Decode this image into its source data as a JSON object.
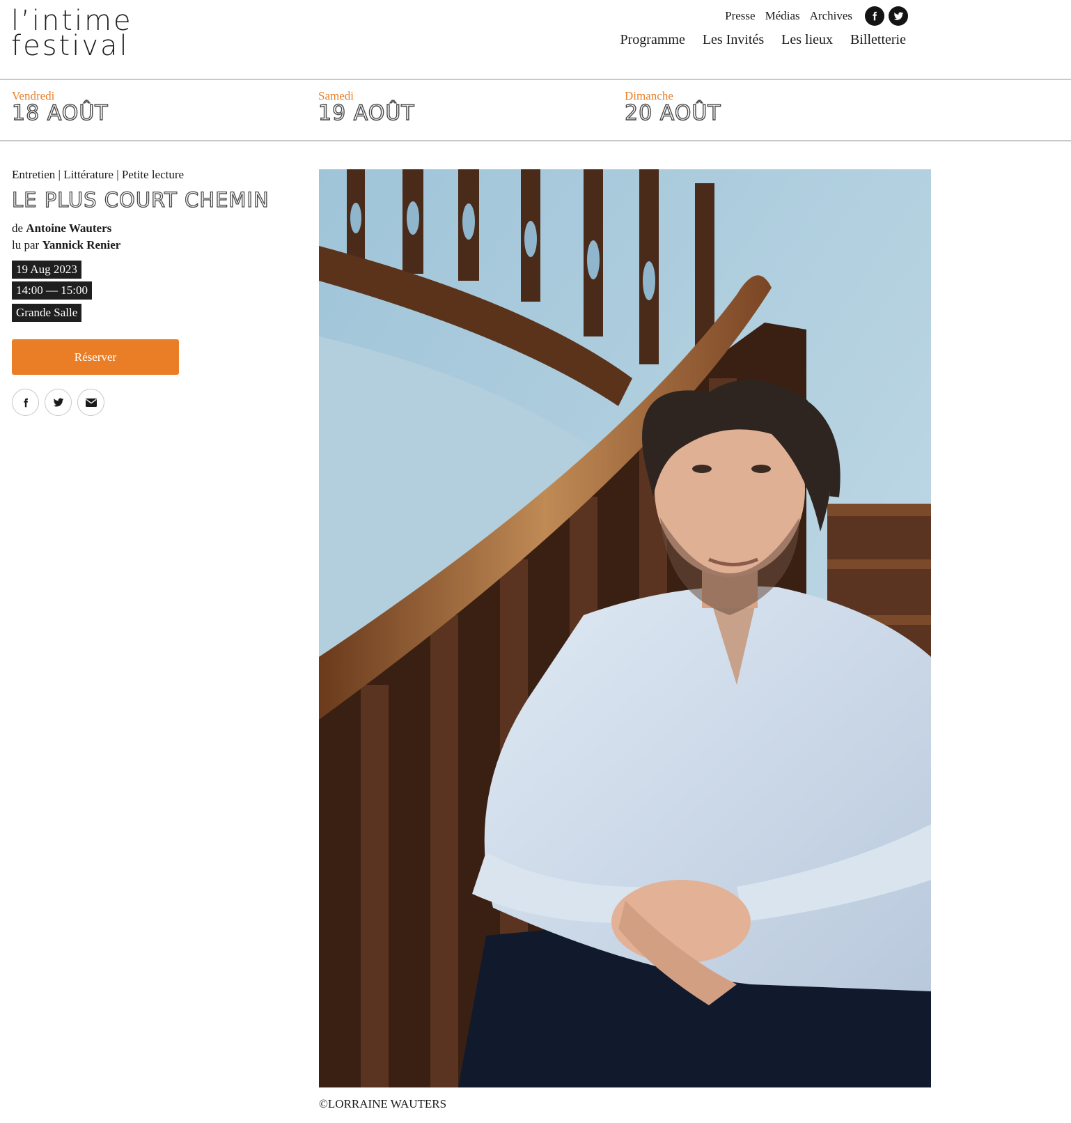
{
  "logo": {
    "line1": "l’intime",
    "line2": "festival"
  },
  "top_links": [
    "Presse",
    "Médias",
    "Archives"
  ],
  "top_social": [
    "facebook-icon",
    "twitter-icon"
  ],
  "nav": [
    "Programme",
    "Les Invités",
    "Les lieux",
    "Billetterie"
  ],
  "days": [
    {
      "name": "Vendredi",
      "date": "18 AOÛT"
    },
    {
      "name": "Samedi",
      "date": "19 AOÛT"
    },
    {
      "name": "Dimanche",
      "date": "20 AOÛT"
    }
  ],
  "event": {
    "categories": "Entretien | Littérature | Petite lecture",
    "title": "LE PLUS COURT CHEMIN",
    "author_prefix": "de",
    "author": "Antoine Wauters",
    "reader_prefix": "lu par",
    "reader": "Yannick Renier",
    "date": "19 Aug 2023",
    "time": "14:00 — 15:00",
    "venue": "Grande Salle",
    "reserve_label": "Réserver"
  },
  "share_icons": [
    "facebook-icon",
    "twitter-icon",
    "mail-icon"
  ],
  "photo_credit": "©LORRAINE WAUTERS",
  "colors": {
    "accent": "#ea7e27",
    "tag_bg": "#1f1f1f",
    "text": "#1a1a1a"
  }
}
